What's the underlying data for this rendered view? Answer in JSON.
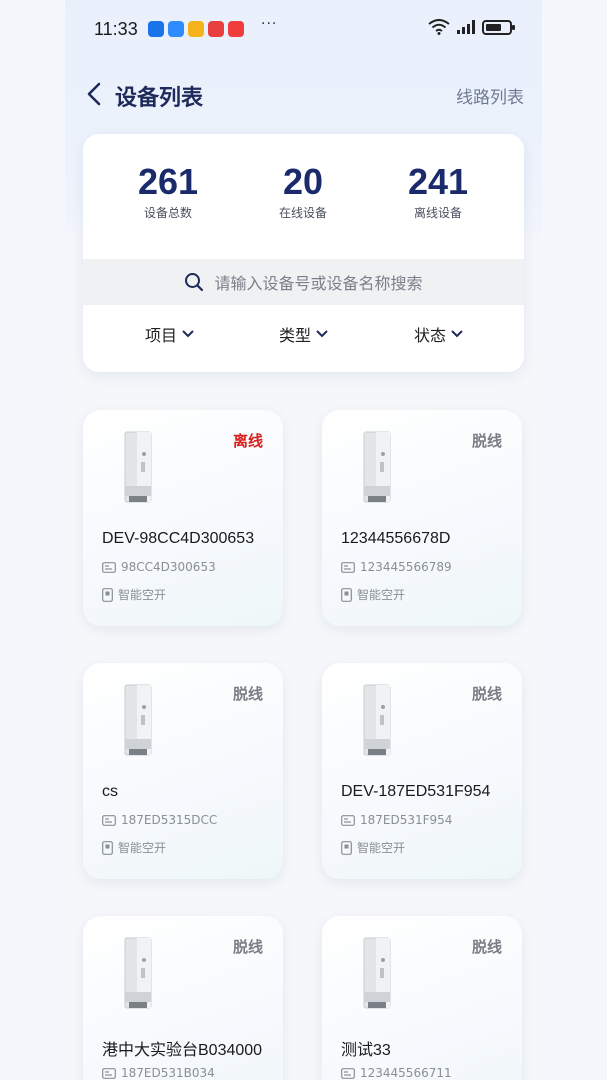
{
  "status_bar": {
    "time": "11:33",
    "more": "···",
    "battery_level": 0.7,
    "app_icon_colors": [
      "#1a73e8",
      "#2f8cff",
      "#f6b21b",
      "#e84040",
      "#ef3c3c"
    ]
  },
  "nav": {
    "title": "设备列表",
    "right_link": "线路列表"
  },
  "summary": {
    "stats": [
      {
        "value": "261",
        "label": "设备总数"
      },
      {
        "value": "20",
        "label": "在线设备"
      },
      {
        "value": "241",
        "label": "离线设备"
      }
    ],
    "search_placeholder": "请输入设备号或设备名称搜索",
    "filters": [
      {
        "label": "项目"
      },
      {
        "label": "类型"
      },
      {
        "label": "状态"
      }
    ]
  },
  "devices": [
    {
      "name": "DEV-98CC4D300653",
      "id": "98CC4D300653",
      "type": "智能空开",
      "status": "离线"
    },
    {
      "name": "12344556678D",
      "id": "123445566789",
      "type": "智能空开",
      "status": "脱线"
    },
    {
      "name": "cs",
      "id": "187ED5315DCC",
      "type": "智能空开",
      "status": "脱线"
    },
    {
      "name": "DEV-187ED531F954",
      "id": "187ED531F954",
      "type": "智能空开",
      "status": "脱线"
    },
    {
      "name": "港中大实验台B034000",
      "id": "187ED531B034",
      "type": "",
      "status": "脱线"
    },
    {
      "name": "测试33",
      "id": "123445566711",
      "type": "",
      "status": "脱线"
    }
  ],
  "colors": {
    "accent": "#1a2a6b",
    "offline_red": "#d6201f",
    "muted": "#7a7d85"
  }
}
